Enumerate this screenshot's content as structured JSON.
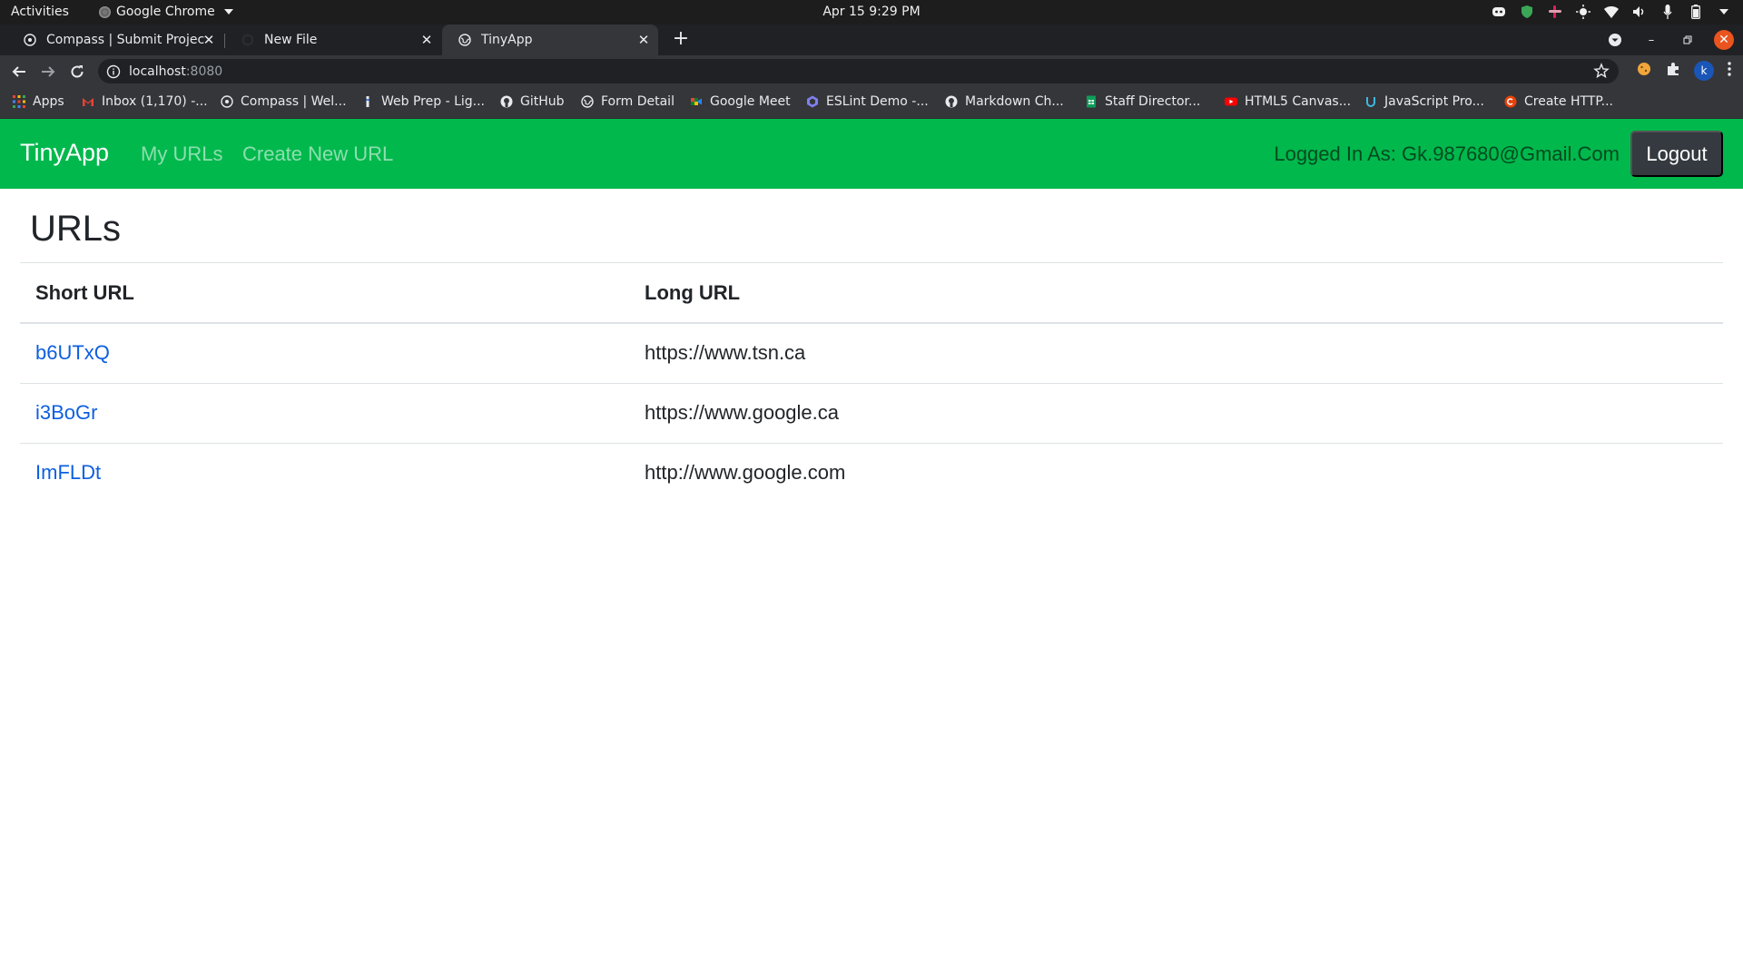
{
  "os_bar": {
    "activities": "Activities",
    "app_name": "Google Chrome",
    "clock": "Apr 15  9:29 PM",
    "tray_icons": [
      "discord-icon",
      "vpn-shield-icon",
      "slack-icon",
      "brightness-icon",
      "wifi-icon",
      "volume-icon",
      "microphone-icon",
      "battery-icon",
      "system-menu-caret-icon"
    ]
  },
  "tabs": [
    {
      "title": "Compass | Submit Project",
      "icon": "compass-icon",
      "active": false
    },
    {
      "title": "New File",
      "icon": "github-icon",
      "active": false
    },
    {
      "title": "TinyApp",
      "icon": "globe-icon",
      "active": true
    }
  ],
  "toolbar": {
    "url_host": "localhost",
    "url_port": ":8080",
    "profile_initial": "k"
  },
  "bookmarks": [
    {
      "label": "Apps",
      "icon": "apps-grid-icon"
    },
    {
      "label": "Inbox (1,170) -...",
      "icon": "gmail-icon"
    },
    {
      "label": "Compass | Wel...",
      "icon": "compass-icon"
    },
    {
      "label": "Web Prep - Lig...",
      "icon": "lighthouse-icon"
    },
    {
      "label": "GitHub",
      "icon": "github-icon"
    },
    {
      "label": "Form Detail",
      "icon": "globe-icon"
    },
    {
      "label": "Google Meet",
      "icon": "google-meet-icon"
    },
    {
      "label": "ESLint Demo -...",
      "icon": "eslint-icon"
    },
    {
      "label": "Markdown Ch...",
      "icon": "github-icon"
    },
    {
      "label": "Staff Director...",
      "icon": "google-sheets-icon"
    },
    {
      "label": "HTML5 Canvas...",
      "icon": "youtube-icon"
    },
    {
      "label": "JavaScript Pro...",
      "icon": "udemy-icon"
    },
    {
      "label": "Create HTTP...",
      "icon": "red-circle-icon"
    }
  ],
  "app": {
    "brand": "TinyApp",
    "nav": {
      "my_urls": "My URLs",
      "create_new": "Create New URL"
    },
    "logged_in": "Logged In As: Gk.987680@Gmail.Com",
    "logout": "Logout",
    "heading": "URLs",
    "table": {
      "headers": [
        "Short URL",
        "Long URL"
      ],
      "rows": [
        {
          "short": "b6UTxQ",
          "long": "https://www.tsn.ca"
        },
        {
          "short": "i3BoGr",
          "long": "https://www.google.ca"
        },
        {
          "short": "ImFLDt",
          "long": "http://www.google.com"
        }
      ]
    }
  },
  "colors": {
    "navbar": "#00b84c",
    "link": "#0d5fe0",
    "logout_button": "#343a40"
  }
}
